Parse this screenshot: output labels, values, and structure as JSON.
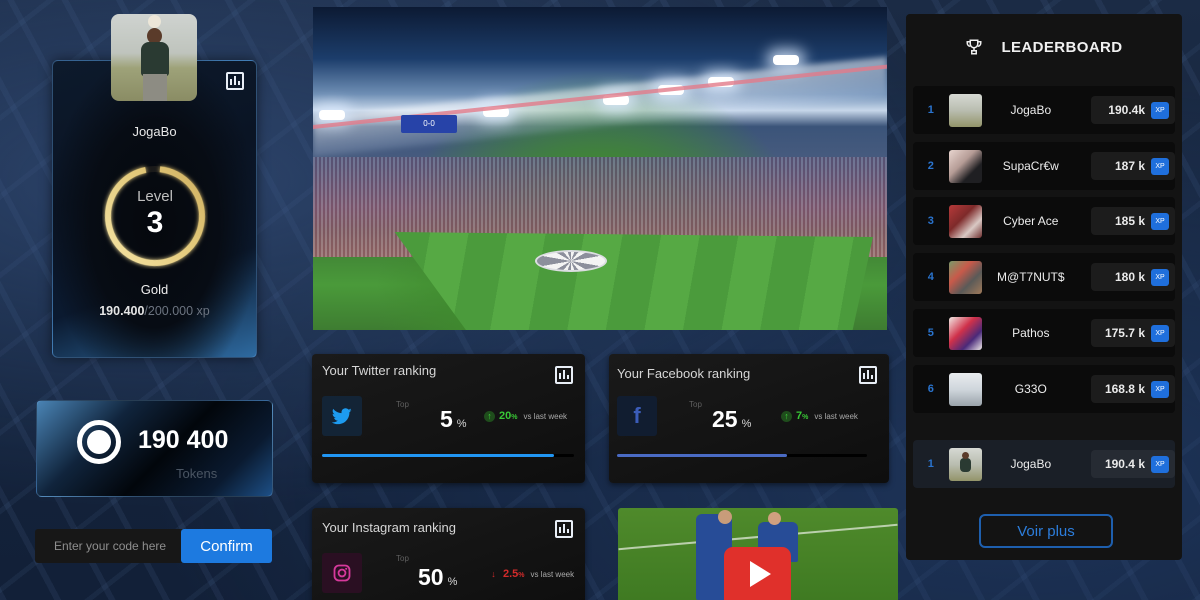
{
  "profile": {
    "username": "JogaBo",
    "level_label": "Level",
    "level": "3",
    "level_progress": 0.95,
    "tier": "Gold",
    "xp_current": "190.400",
    "xp_total": "/200.000 xp",
    "stats_icon": "bar-chart-icon",
    "ring_color": "#e8d18a"
  },
  "tokens": {
    "value": "190 400",
    "label": "Tokens",
    "icon": "token-coin-icon"
  },
  "code_redeem": {
    "placeholder": "Enter your code here",
    "value": "",
    "confirm_label": "Confirm"
  },
  "hero_image": {
    "description": "stadium-photo",
    "scoreboard_text": "0-0"
  },
  "rankings": [
    {
      "id": "twitter",
      "title": "Your Twitter ranking",
      "icon": "twitter-icon",
      "icon_color": "#1d9bf0",
      "top_label": "Top",
      "value": "5",
      "unit": "%",
      "delta_direction": "up",
      "delta_value": "20",
      "delta_unit": "%",
      "delta_text": "vs last week",
      "progress": 0.92,
      "bar_color": "#2196f3"
    },
    {
      "id": "facebook",
      "title": "Your Facebook ranking",
      "icon": "facebook-icon",
      "icon_color": "#3b5cb8",
      "top_label": "Top",
      "value": "25",
      "unit": "%",
      "delta_direction": "up",
      "delta_value": "7",
      "delta_unit": "%",
      "delta_text": "vs last week",
      "progress": 0.68,
      "bar_color": "#4a6bc4"
    },
    {
      "id": "instagram",
      "title": "Your Instagram ranking",
      "icon": "instagram-icon",
      "icon_color": "#d6399b",
      "top_label": "Top",
      "value": "50",
      "unit": "%",
      "delta_direction": "down",
      "delta_value": "2.5",
      "delta_unit": "%",
      "delta_text": "vs last week"
    }
  ],
  "video": {
    "play_icon": "play-icon",
    "play_color": "#e0302b"
  },
  "leaderboard": {
    "title": "LEADERBOARD",
    "icon": "trophy-icon",
    "xp_badge": "XP",
    "entries": [
      {
        "rank": "1",
        "name": "JogaBo",
        "score": "190.4k"
      },
      {
        "rank": "2",
        "name": "SupaCr€w",
        "score": "187 k"
      },
      {
        "rank": "3",
        "name": "Cyber Ace",
        "score": "185 k"
      },
      {
        "rank": "4",
        "name": "M@T7NUT$",
        "score": "180 k"
      },
      {
        "rank": "5",
        "name": "Pathos",
        "score": "175.7 k"
      },
      {
        "rank": "6",
        "name": "G33O",
        "score": "168.8 k"
      }
    ],
    "current_user": {
      "rank": "1",
      "name": "JogaBo",
      "score": "190.4 k"
    },
    "see_more_label": "Voir plus"
  }
}
